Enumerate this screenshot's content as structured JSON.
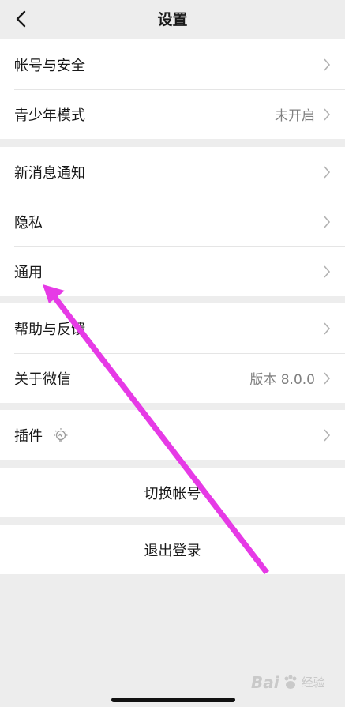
{
  "nav": {
    "title": "设置"
  },
  "groups": [
    [
      {
        "name": "account-security",
        "label": "帐号与安全",
        "value": ""
      },
      {
        "name": "teen-mode",
        "label": "青少年模式",
        "value": "未开启"
      }
    ],
    [
      {
        "name": "new-message-notification",
        "label": "新消息通知",
        "value": ""
      },
      {
        "name": "privacy",
        "label": "隐私",
        "value": ""
      },
      {
        "name": "general",
        "label": "通用",
        "value": ""
      }
    ],
    [
      {
        "name": "help-feedback",
        "label": "帮助与反馈",
        "value": ""
      },
      {
        "name": "about-wechat",
        "label": "关于微信",
        "value": "版本 8.0.0"
      }
    ],
    [
      {
        "name": "plugins",
        "label": "插件",
        "value": ""
      }
    ]
  ],
  "actions": {
    "switch_account": "切换帐号",
    "logout": "退出登录"
  },
  "watermark": {
    "brand": "Bai",
    "suffix": "经验"
  },
  "colors": {
    "annotation_arrow": "#e63ae6",
    "separator": "#e5e5e5",
    "background": "#ededed"
  }
}
